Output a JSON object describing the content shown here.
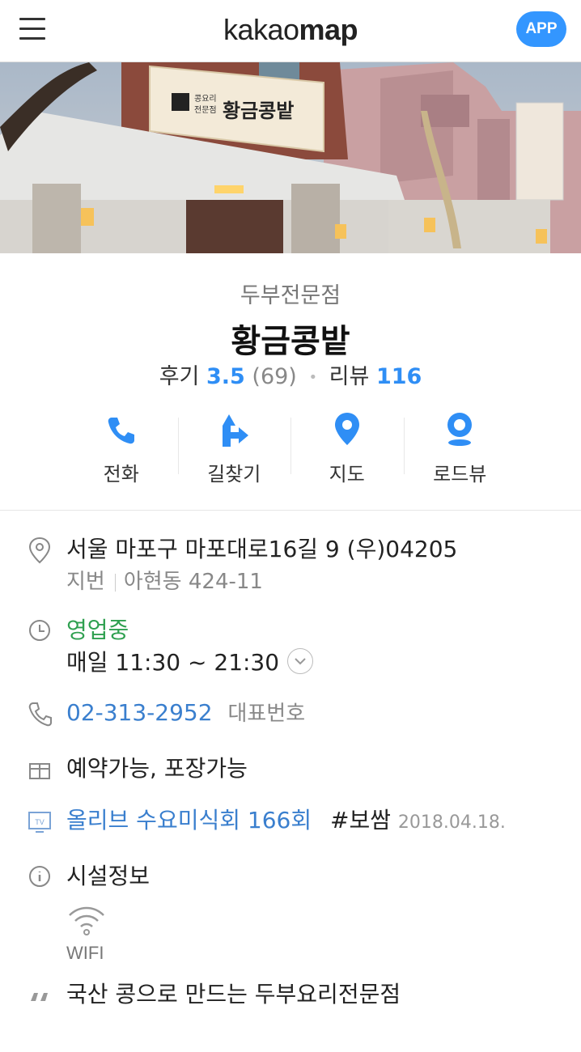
{
  "header": {
    "logo_kakao": "kakao",
    "logo_map": "map",
    "app_button": "APP"
  },
  "place": {
    "category": "두부전문점",
    "name": "황금콩밭",
    "review_label": "후기",
    "review_score": "3.5",
    "review_count": "(69)",
    "blog_label": "리뷰",
    "blog_count": "116",
    "sign_text": "황금콩밭",
    "sign_small_1": "콩요리",
    "sign_small_2": "전문점"
  },
  "actions": [
    {
      "label": "전화",
      "icon": "phone-icon"
    },
    {
      "label": "길찾기",
      "icon": "directions-icon"
    },
    {
      "label": "지도",
      "icon": "map-pin-icon"
    },
    {
      "label": "로드뷰",
      "icon": "roadview-icon"
    }
  ],
  "details": {
    "address": "서울 마포구 마포대로16길 9 (우)04205",
    "lot_label": "지번",
    "lot_address": "아현동 424-11",
    "status": "영업중",
    "hours": "매일 11:30 ~ 21:30",
    "phone": "02-313-2952",
    "phone_note": "대표번호",
    "services": "예약가능, 포장가능",
    "tv_program": "올리브 수요미식회 166회",
    "tv_tag": "#보쌈",
    "tv_date": "2018.04.18.",
    "facility_title": "시설정보",
    "wifi_label": "WIFI",
    "description": "국산 콩으로 만드는 두부요리전문점"
  },
  "colors": {
    "accent": "#3396ff",
    "link": "#3a7fce",
    "open_status": "#2fa050"
  }
}
